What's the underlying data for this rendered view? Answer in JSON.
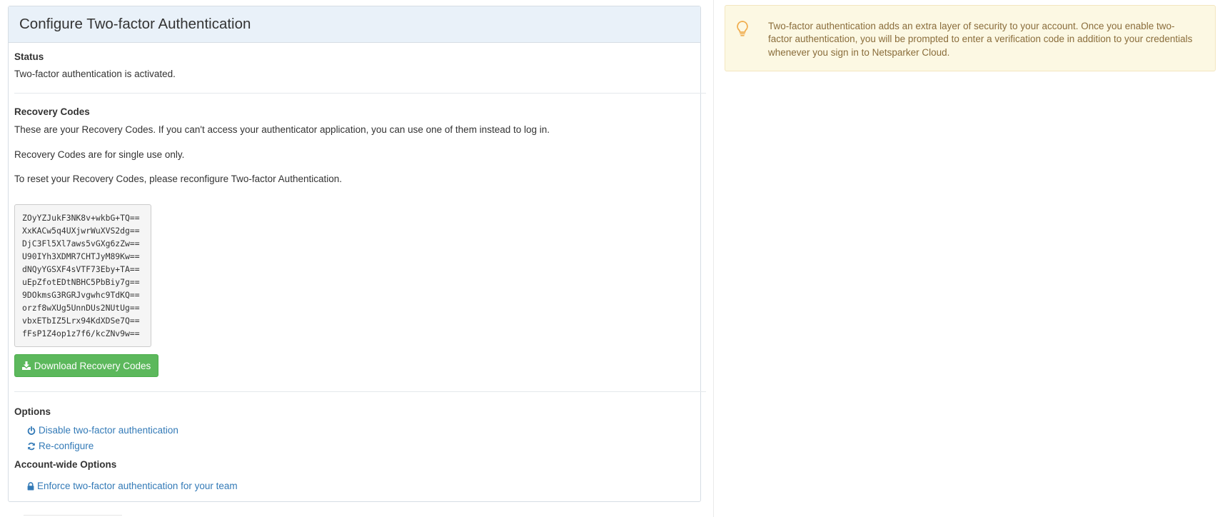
{
  "config_panel": {
    "title": "Configure Two-factor Authentication",
    "status": {
      "heading": "Status",
      "text": "Two-factor authentication is activated."
    },
    "recovery": {
      "heading": "Recovery Codes",
      "line1": "These are your Recovery Codes. If you can't access your authenticator application, you can use one of them instead to log in.",
      "line2": "Recovery Codes are for single use only.",
      "line3": "To reset your Recovery Codes, please reconfigure Two-factor Authentication.",
      "codes": [
        "ZOyYZJukF3NK8v+wkbG+TQ==",
        "XxKACw5q4UXjwrWuXVS2dg==",
        "DjC3Fl5Xl7aws5vGXg6zZw==",
        "U90IYh3XDMR7CHTJyM89Kw==",
        "dNQyYGSXF4sVTF73Eby+TA==",
        "uEpZfotEDtNBHC5PbBiy7g==",
        "9DOkmsG3RGRJvgwhc9TdKQ==",
        "orzf8wXUg5UnnDUs2NUtUg==",
        "vbxETbIZ5Lrx94KdXDSe7Q==",
        "fFsP1Z4op1z7f6/kcZNv9w=="
      ],
      "download_label": "Download Recovery Codes",
      "download_icon": "download-icon"
    },
    "options": {
      "heading": "Options",
      "disable_label": "Disable two-factor authentication",
      "disable_icon": "power-icon",
      "reconfigure_label": "Re-configure",
      "reconfigure_icon": "refresh-icon"
    },
    "account_options": {
      "heading": "Account-wide Options",
      "enforce_label": "Enforce two-factor authentication for your team",
      "enforce_icon": "lock-icon"
    }
  },
  "info_alert": {
    "icon": "lightbulb-icon",
    "text": "Two-factor authentication adds an extra layer of security to your account. Once you enable two-factor authentication, you will be prompted to enter a verification code in addition to your credentials whenever you sign in to Netsparker Cloud."
  },
  "colors": {
    "heading_bg": "#e9f1f9",
    "success": "#5cb85c",
    "link": "#337ab7",
    "alert_bg": "#fcf8e3",
    "alert_text": "#8a6d3b",
    "alert_icon": "#f0ad4e"
  }
}
